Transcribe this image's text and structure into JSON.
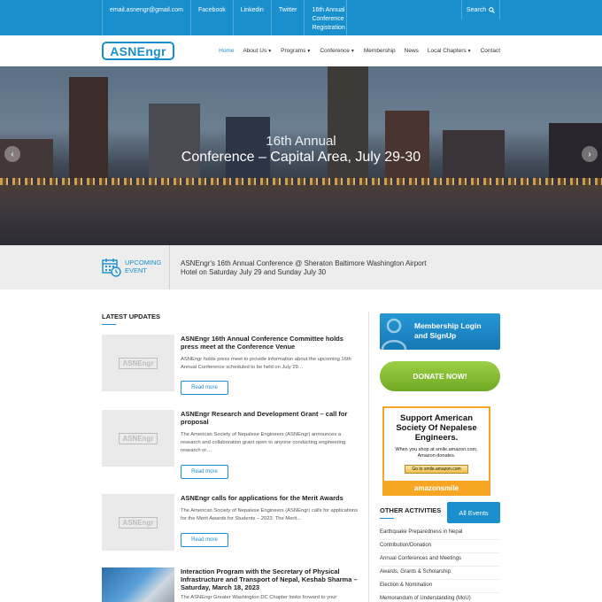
{
  "topbar": {
    "email": "email.asnengr@gmail.com",
    "facebook": "Facebook",
    "linkedin": "Linkedin",
    "twitter": "Twitter",
    "registration": "16th Annual Conference Registration",
    "search": "Search"
  },
  "header": {
    "logo": "ASNEngr",
    "nav": [
      {
        "label": "Home",
        "active": true
      },
      {
        "label": "About Us",
        "dropdown": true
      },
      {
        "label": "Programs",
        "dropdown": true
      },
      {
        "label": "Conference",
        "dropdown": true
      },
      {
        "label": "Membership"
      },
      {
        "label": "News"
      },
      {
        "label": "Local Chapters",
        "dropdown": true
      },
      {
        "label": "Contact"
      }
    ]
  },
  "hero": {
    "line1": "16th Annual",
    "line2": "Conference – Capital Area, July 29-30"
  },
  "event": {
    "label_line1": "UPCOMING",
    "label_line2": "EVENT",
    "text": "ASNEngr's 16th Annual Conference @ Sheraton Baltimore Washington Airport Hotel on Saturday July 29 and Sunday July 30",
    "button": "All Events"
  },
  "latest": {
    "heading": "LATEST UPDATES",
    "read_more": "Read more",
    "thumb_logo": "ASNEngr",
    "posts": [
      {
        "title": "ASNEngr 16th Annual Conference Committee holds press meet at the Conference Venue",
        "excerpt": "ASNEngr holds press meet to provide information about the upcoming 16th Annual Conference scheduled to be held on July 29…"
      },
      {
        "title": "ASNEngr Research and Development Grant – call for proposal",
        "excerpt": "The American Society of Nepalese Engineers (ASNEngr) announces a research and collaboration grant open to anyone conducting engineering research or…"
      },
      {
        "title": "ASNEngr calls for applications for the Merit Awards",
        "excerpt": "The American Society of Nepalese Engineers (ASNEngr) calls for applications for the Merit Awards for Students – 2023. The Merit…"
      },
      {
        "title": "Interaction Program with the Secretary of Physical Infrastructure and Transport of Nepal, Keshab Sharma – Saturday, March 18, 2023",
        "excerpt": "The ASNEngr Greater Washington DC Chapter looks forward to your"
      }
    ]
  },
  "sidebar": {
    "membership": "Membership Login and SignUp",
    "donate": "DONATE NOW!",
    "amazon": {
      "headline": "Support American Society Of Nepalese Engineers.",
      "sub_line1": "When you shop at smile.amazon.com,",
      "sub_line2": "Amazon donates.",
      "button": "Go to smile.amazon.com",
      "brand": "amazonsmile"
    },
    "other_heading": "OTHER ACTIVITIES",
    "other_items": [
      "Earthquake Preparedness in Nepal",
      "Contribution/Donation",
      "Annual Conferences and Meetings",
      "Awards, Grants & Scholarship",
      "Election & Nomination",
      "Memorandum of Understanding (MoU)"
    ]
  }
}
